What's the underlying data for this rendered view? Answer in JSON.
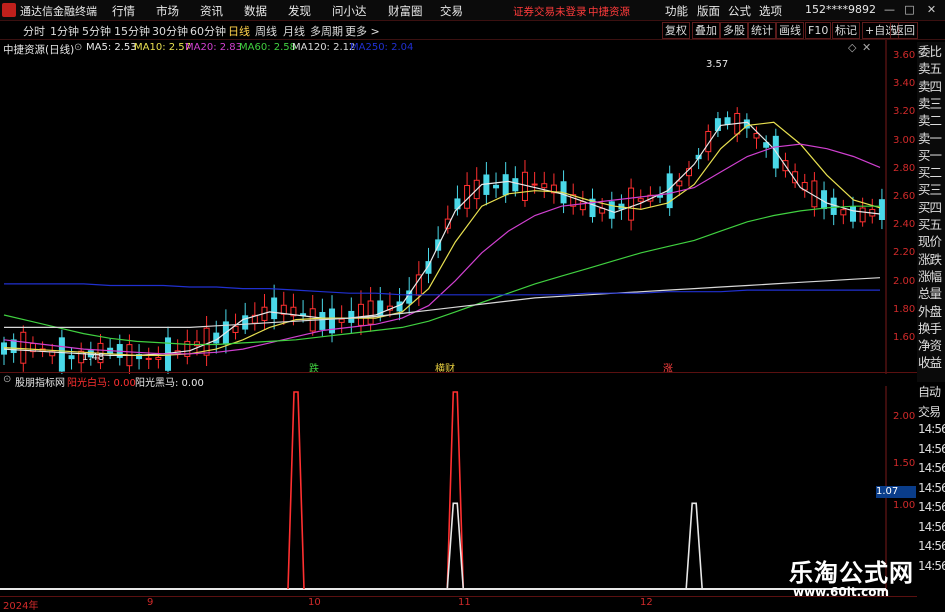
{
  "app": {
    "name": "通达信金融终端",
    "brand_color": "#c0201c"
  },
  "menu": [
    "行情",
    "市场",
    "资讯",
    "数据",
    "发现",
    "问小达",
    "财富圈",
    "交易"
  ],
  "warning": [
    "证券交易未登录",
    "中捷资源"
  ],
  "right_menu": [
    "功能",
    "版面",
    "公式",
    "选项"
  ],
  "user": "152****9892",
  "periods": [
    "分时",
    "1分钟",
    "5分钟",
    "15分钟",
    "30分钟",
    "60分钟",
    "日线",
    "周线",
    "月线",
    "多周期",
    "更多 >"
  ],
  "active_period": "日线",
  "toolbar": [
    "复权",
    "叠加",
    "多股",
    "统计",
    "画线",
    "F10",
    "标记",
    "+自选",
    "返回"
  ],
  "chart_title": "中捷资源(日线)",
  "ma_legend": [
    {
      "text": "MA5: 2.53",
      "color": "#e8e8e8"
    },
    {
      "text": "MA10: 2.57",
      "color": "#e8e050"
    },
    {
      "text": "MA20: 2.83",
      "color": "#d040d0"
    },
    {
      "text": "MA60: 2.58",
      "color": "#40d040"
    },
    {
      "text": "MA120: 2.12",
      "color": "#d8d8d8"
    },
    {
      "text": "MA250: 2.04",
      "color": "#2030d0"
    }
  ],
  "price_axis": [
    "3.60",
    "3.40",
    "3.20",
    "3.00",
    "2.80",
    "2.60",
    "2.40",
    "2.20",
    "2.00",
    "1.80",
    "1.60"
  ],
  "annotations": {
    "high": "3.57",
    "low": "1.48"
  },
  "signals": [
    {
      "text": "跌",
      "color": "#40d040"
    },
    {
      "text": "横财",
      "color": "#e8d040"
    },
    {
      "text": "涨",
      "color": "#ff4040"
    }
  ],
  "right_panel": [
    "委比",
    "卖五",
    "卖四",
    "卖三",
    "卖二",
    "卖一",
    "买一",
    "买二",
    "买三",
    "买四",
    "买五",
    "现价",
    "涨跌",
    "涨幅",
    "总量",
    "外盘",
    "换手",
    "净资",
    "收益"
  ],
  "right_panel2": [
    "自动",
    "交易",
    "14:56",
    "14:56",
    "14:56",
    "14:56",
    "14:56",
    "14:56",
    "14:56",
    "14:56"
  ],
  "indicator": {
    "name": "股朋指标网",
    "legend": [
      {
        "text": "阳光白马: 0.00",
        "color": "#ff3030"
      },
      {
        "text": "阳光黑马: 0.00",
        "color": "#e8e8e8"
      }
    ],
    "axis": [
      "2.00",
      "1.50",
      "1.00"
    ],
    "cursor_value": "1.07"
  },
  "x_labels": [
    "2024年",
    "9",
    "10",
    "11",
    "12"
  ],
  "watermark": {
    "line1": "乐淘公式网",
    "line2": "www.60lt.com"
  },
  "chart_data": [
    {
      "type": "line",
      "title": "中捷资源(日线)",
      "ylim": [
        1.5,
        3.65
      ],
      "x_labels": [
        "2024年",
        "9",
        "10",
        "11",
        "12"
      ],
      "series": [
        {
          "name": "MA5",
          "color": "#e8e8e8",
          "values": [
            1.66,
            1.65,
            1.64,
            1.63,
            1.62,
            1.62,
            1.63,
            1.65,
            1.72,
            1.85,
            1.9,
            1.88,
            1.86,
            1.86,
            1.88,
            1.95,
            2.2,
            2.55,
            2.72,
            2.74,
            2.7,
            2.66,
            2.6,
            2.54,
            2.6,
            2.68,
            2.85,
            3.1,
            3.12,
            2.95,
            2.7,
            2.6,
            2.55,
            2.53
          ]
        },
        {
          "name": "MA10",
          "color": "#e8e050",
          "values": [
            1.67,
            1.66,
            1.65,
            1.64,
            1.63,
            1.62,
            1.62,
            1.63,
            1.66,
            1.72,
            1.8,
            1.85,
            1.86,
            1.86,
            1.86,
            1.9,
            2.05,
            2.35,
            2.58,
            2.66,
            2.68,
            2.67,
            2.62,
            2.58,
            2.56,
            2.6,
            2.72,
            2.95,
            3.1,
            3.12,
            2.98,
            2.78,
            2.62,
            2.57
          ]
        },
        {
          "name": "MA20",
          "color": "#d040d0",
          "values": [
            1.72,
            1.7,
            1.68,
            1.66,
            1.65,
            1.64,
            1.63,
            1.63,
            1.64,
            1.66,
            1.7,
            1.74,
            1.78,
            1.8,
            1.82,
            1.86,
            1.94,
            2.1,
            2.28,
            2.42,
            2.52,
            2.58,
            2.6,
            2.62,
            2.64,
            2.66,
            2.7,
            2.8,
            2.9,
            2.96,
            2.98,
            2.95,
            2.9,
            2.83
          ]
        },
        {
          "name": "MA60",
          "color": "#40d040",
          "values": [
            1.88,
            1.84,
            1.8,
            1.76,
            1.73,
            1.71,
            1.7,
            1.69,
            1.69,
            1.7,
            1.71,
            1.72,
            1.74,
            1.76,
            1.78,
            1.8,
            1.84,
            1.9,
            1.96,
            2.02,
            2.08,
            2.13,
            2.18,
            2.23,
            2.28,
            2.32,
            2.36,
            2.42,
            2.48,
            2.52,
            2.55,
            2.57,
            2.58,
            2.58
          ]
        },
        {
          "name": "MA120",
          "color": "#d8d8d8",
          "values": [
            1.8,
            1.8,
            1.8,
            1.8,
            1.8,
            1.8,
            1.8,
            1.8,
            1.81,
            1.82,
            1.83,
            1.84,
            1.85,
            1.86,
            1.87,
            1.89,
            1.91,
            1.93,
            1.95,
            1.97,
            1.99,
            2.0,
            2.01,
            2.02,
            2.03,
            2.04,
            2.05,
            2.06,
            2.07,
            2.08,
            2.09,
            2.1,
            2.11,
            2.12
          ]
        },
        {
          "name": "MA250",
          "color": "#2030d0",
          "values": [
            2.08,
            2.08,
            2.08,
            2.08,
            2.07,
            2.07,
            2.07,
            2.06,
            2.06,
            2.05,
            2.05,
            2.04,
            2.03,
            2.02,
            2.02,
            2.01,
            2.01,
            2.01,
            2.01,
            2.01,
            2.01,
            2.01,
            2.02,
            2.02,
            2.02,
            2.03,
            2.03,
            2.03,
            2.04,
            2.04,
            2.04,
            2.04,
            2.04,
            2.04
          ]
        }
      ]
    },
    {
      "type": "line",
      "title": "股朋指标网",
      "ylim": [
        0,
        2.3
      ],
      "series": [
        {
          "name": "阳光白马",
          "color": "#ff3030",
          "values": [
            0,
            0,
            0,
            0,
            0,
            0,
            0,
            0,
            0,
            0,
            0,
            2.3,
            0,
            0,
            0,
            0,
            0,
            2.3,
            0,
            0,
            0,
            0,
            0,
            0,
            0,
            0,
            0,
            0,
            0,
            0,
            0,
            0,
            0,
            0
          ]
        },
        {
          "name": "阳光黑马",
          "color": "#e8e8e8",
          "values": [
            0,
            0,
            0,
            0,
            0,
            0,
            0,
            0,
            0,
            0,
            0,
            0,
            0,
            0,
            0,
            0,
            0,
            1.0,
            0,
            0,
            0,
            0,
            0,
            0,
            0,
            0,
            1.0,
            0,
            0,
            0,
            0,
            0,
            0,
            0
          ]
        }
      ]
    }
  ]
}
